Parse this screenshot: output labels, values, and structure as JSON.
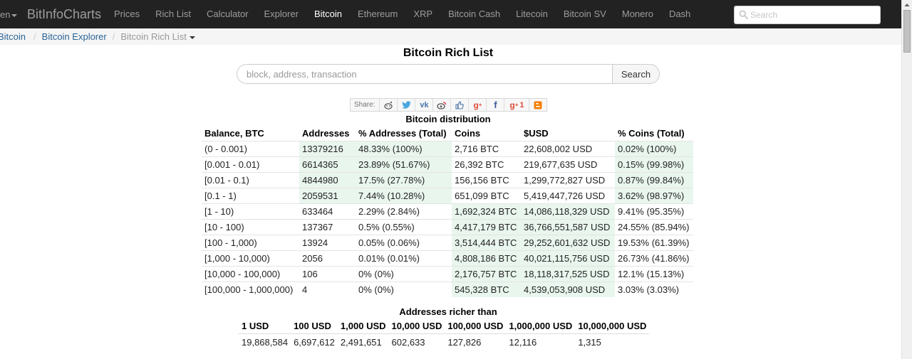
{
  "navbar": {
    "lang": "en",
    "brand": "BitInfoCharts",
    "links": [
      "Prices",
      "Rich List",
      "Calculator",
      "Explorer",
      "Bitcoin",
      "Ethereum",
      "XRP",
      "Bitcoin Cash",
      "Litecoin",
      "Bitcoin SV",
      "Monero",
      "Dash"
    ],
    "active": "Bitcoin",
    "search_placeholder": "Search"
  },
  "breadcrumb": {
    "items": [
      "Bitcoin",
      "Bitcoin Explorer"
    ],
    "current": "Bitcoin Rich List"
  },
  "page": {
    "title": "Bitcoin Rich List",
    "search_placeholder": "block, address, transaction",
    "search_button": "Search"
  },
  "share": {
    "label": "Share:",
    "icons": [
      "reddit-icon",
      "twitter-icon",
      "vk-icon",
      "weibo-icon",
      "like-icon",
      "google-plus-icon",
      "facebook-icon",
      "google-plus-one-icon",
      "blogger-icon"
    ],
    "gplus_count": "1"
  },
  "distribution": {
    "title": "Bitcoin distribution",
    "headers": [
      "Balance, BTC",
      "Addresses",
      "% Addresses (Total)",
      "Coins",
      "$USD",
      "% Coins (Total)"
    ],
    "rows": [
      [
        "(0 - 0.001)",
        "13379216",
        "48.33% (100%)",
        "2,716 BTC",
        "22,608,002 USD",
        "0.02% (100%)"
      ],
      [
        "[0.001 - 0.01)",
        "6614365",
        "23.89% (51.67%)",
        "26,392 BTC",
        "219,677,635 USD",
        "0.15% (99.98%)"
      ],
      [
        "[0.01 - 0.1)",
        "4844980",
        "17.5% (27.78%)",
        "156,156 BTC",
        "1,299,772,827 USD",
        "0.87% (99.84%)"
      ],
      [
        "[0.1 - 1)",
        "2059531",
        "7.44% (10.28%)",
        "651,099 BTC",
        "5,419,447,726 USD",
        "3.62% (98.97%)"
      ],
      [
        "[1 - 10)",
        "633464",
        "2.29% (2.84%)",
        "1,692,324 BTC",
        "14,086,118,329 USD",
        "9.41% (95.35%)"
      ],
      [
        "[10 - 100)",
        "137367",
        "0.5% (0.55%)",
        "4,417,179 BTC",
        "36,766,551,587 USD",
        "24.55% (85.94%)"
      ],
      [
        "[100 - 1,000)",
        "13924",
        "0.05% (0.06%)",
        "3,514,444 BTC",
        "29,252,601,632 USD",
        "19.53% (61.39%)"
      ],
      [
        "[1,000 - 10,000)",
        "2056",
        "0.01% (0.01%)",
        "4,808,186 BTC",
        "40,021,115,756 USD",
        "26.73% (41.86%)"
      ],
      [
        "[10,000 - 100,000)",
        "106",
        "0% (0%)",
        "2,176,757 BTC",
        "18,118,317,525 USD",
        "12.1% (15.13%)"
      ],
      [
        "[100,000 - 1,000,000)",
        "4",
        "0% (0%)",
        "545,328 BTC",
        "4,539,053,908 USD",
        "3.03% (3.03%)"
      ]
    ],
    "highlight": [
      [
        false,
        true,
        true,
        false,
        false,
        true
      ],
      [
        false,
        true,
        true,
        false,
        false,
        true
      ],
      [
        false,
        true,
        true,
        false,
        false,
        true
      ],
      [
        false,
        true,
        true,
        false,
        false,
        true
      ],
      [
        false,
        false,
        false,
        true,
        true,
        false
      ],
      [
        false,
        false,
        false,
        true,
        true,
        false
      ],
      [
        false,
        false,
        false,
        true,
        true,
        false
      ],
      [
        false,
        false,
        false,
        true,
        true,
        false
      ],
      [
        false,
        false,
        false,
        true,
        true,
        false
      ],
      [
        false,
        false,
        false,
        true,
        true,
        false
      ]
    ],
    "highlight_color": "#e9f6ee"
  },
  "richer": {
    "title": "Addresses richer than",
    "headers": [
      "1 USD",
      "100 USD",
      "1,000 USD",
      "10,000 USD",
      "100,000 USD",
      "1,000,000 USD",
      "10,000,000 USD"
    ],
    "values": [
      "19,868,584",
      "6,697,612",
      "2,491,651",
      "602,633",
      "127,826",
      "12,116",
      "1,315"
    ]
  },
  "colors": {
    "navbar_bg": "#222222",
    "nav_text": "#9d9d9d",
    "nav_active": "#ffffff",
    "link": "#2a6496",
    "breadcrumb_bg": "#f5f5f5"
  }
}
